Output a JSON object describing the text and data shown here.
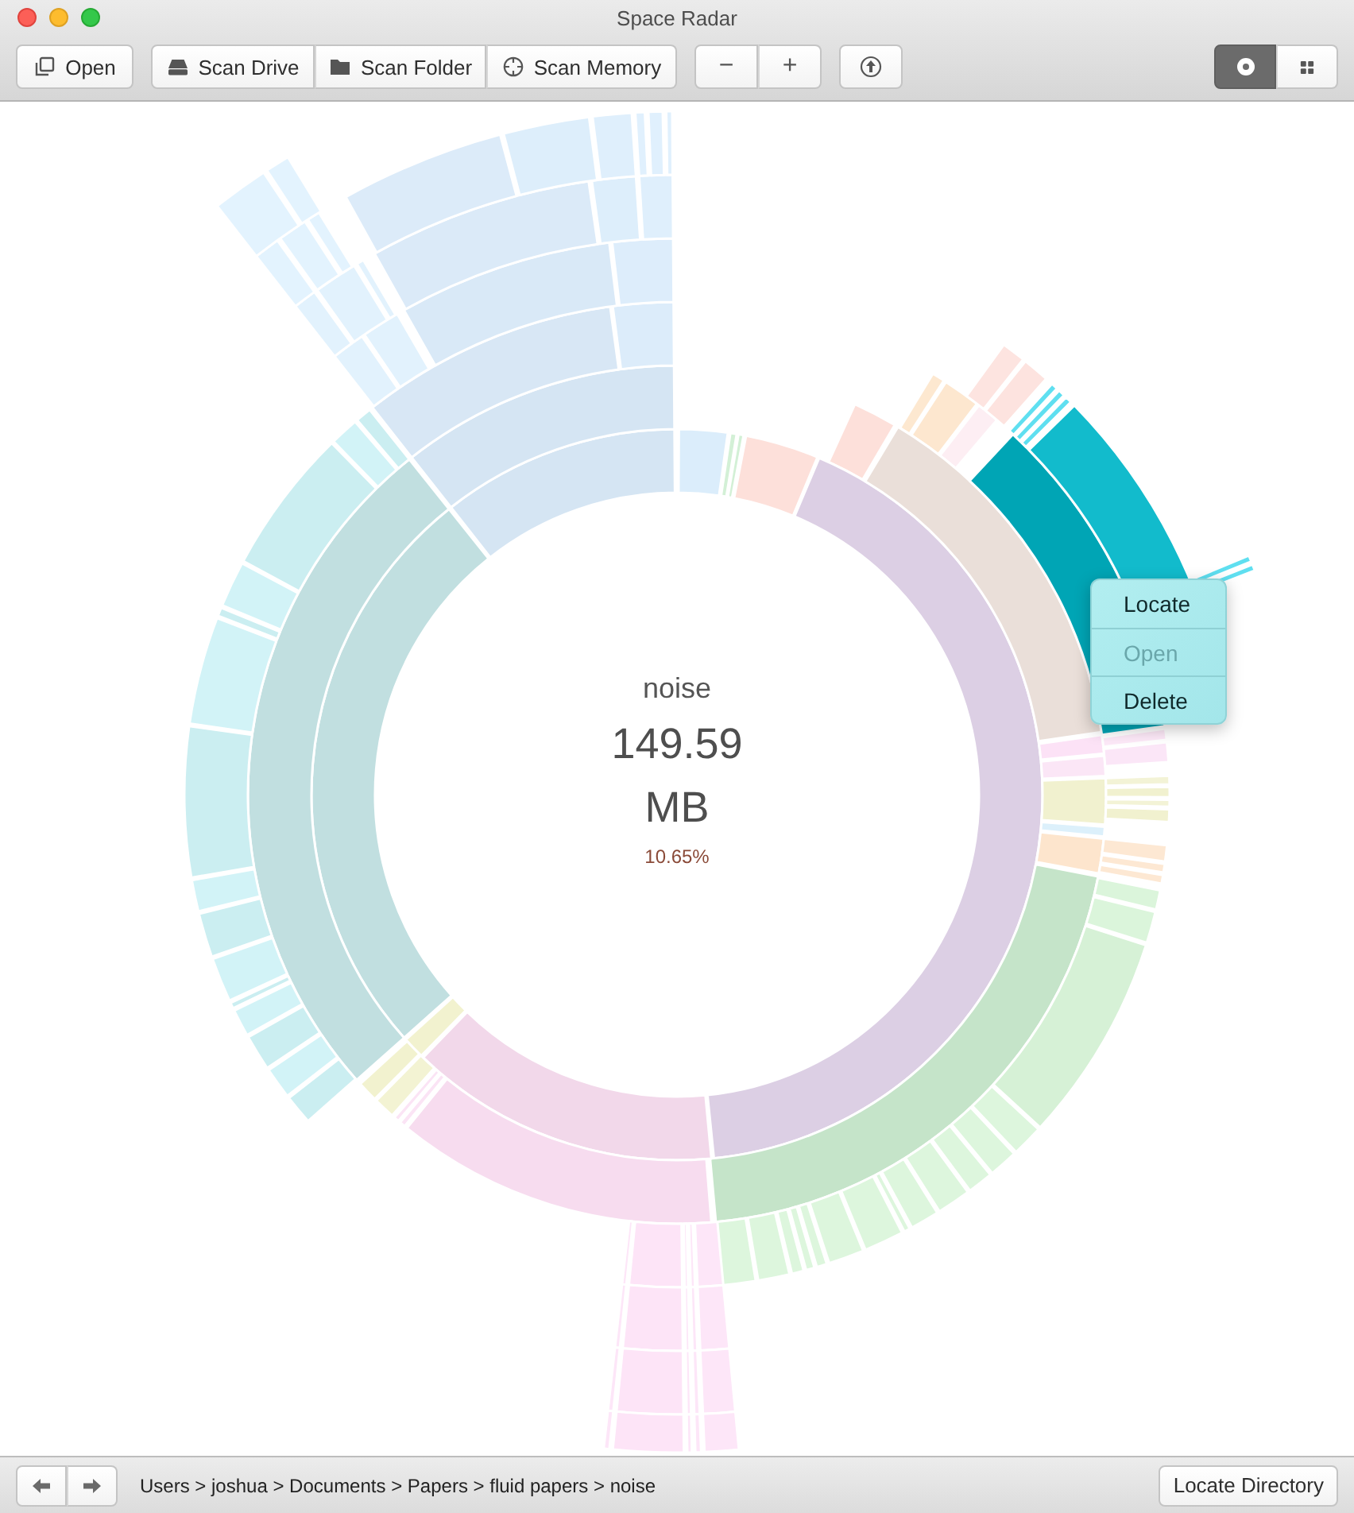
{
  "window": {
    "title": "Space Radar"
  },
  "toolbar": {
    "open_button": {
      "label": "Open"
    },
    "scan_buttons": [
      {
        "label": "Scan Drive",
        "kind": "drive"
      },
      {
        "label": "Scan Folder",
        "kind": "folder"
      },
      {
        "label": "Scan Memory",
        "kind": "memory"
      }
    ],
    "zoom_buttons": [
      {
        "label": "−"
      },
      {
        "label": "+"
      }
    ],
    "view_toggles": [
      {
        "kind": "sunburst",
        "selected": true
      },
      {
        "kind": "treemap",
        "selected": false
      }
    ]
  },
  "center": {
    "name": "noise",
    "size": "149.59",
    "unit": "MB",
    "percent": "10.65%"
  },
  "context_menu": {
    "items": [
      {
        "label": "Locate",
        "disabled": false
      },
      {
        "label": "Open",
        "disabled": true
      },
      {
        "label": "Delete",
        "disabled": false
      }
    ]
  },
  "status_bar": {
    "breadcrumb": "Users > joshua > Documents > Papers > fluid papers > noise",
    "locate_button": {
      "label": "Locate Directory"
    }
  }
}
